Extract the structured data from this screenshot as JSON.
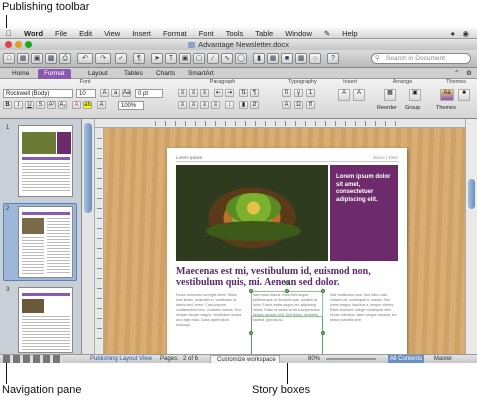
{
  "callouts": {
    "publishing_toolbar": "Publishing toolbar",
    "navigation_pane": "Navigation pane",
    "story_boxes": "Story boxes"
  },
  "menubar": {
    "items": [
      "Word",
      "File",
      "Edit",
      "View",
      "Insert",
      "Format",
      "Font",
      "Tools",
      "Table",
      "Window",
      "Help"
    ]
  },
  "window": {
    "title": "Advantage Newsletter.docx"
  },
  "toolbar": {
    "search_placeholder": "Search in Document"
  },
  "ribbon": {
    "tabs": [
      "Home",
      "Format",
      "Layout",
      "Tables",
      "Charts",
      "SmartArt"
    ],
    "active_tab": "Format",
    "groups": [
      "Font",
      "Paragraph",
      "Typography",
      "Insert",
      "Arrange",
      "Themes"
    ],
    "font_name": "Rockwell (Body)",
    "font_size": "10",
    "spacing": "0 pt",
    "zoom_field": "100%",
    "arrange_labels": [
      "Reorder",
      "Group",
      "Themes"
    ]
  },
  "thumbnails": [
    {
      "num": "1"
    },
    {
      "num": "2"
    },
    {
      "num": "3"
    }
  ],
  "page": {
    "header_left": "Lorem Ipsum",
    "header_right": "Name | Date",
    "purple_text": "Lorem ipsum dolor sit amet, consectetuer adipiscing elit.",
    "headline": "Maecenas est mi, vestibulum id, euismod non, vestibulum quis, mi. Aenean sed dolor.",
    "col1": "Fusce commodo orci eget lorem. Etiam eros lectus, venenatis in, vestibulum et, lacinia sed, lorem. Cras posuere condimentum eros. Curabitur mauris. Sed semper tempor magna. Vestibulum lacinia arcu eget nulla. Class aptent taciti sociosqu.",
    "col2": "Nam nulla mauris. Nunc felis augue, pellentesque id, tincidunt quis, sodales at, dolor. Fusce mattis augue vel, adipiscing varius. Etiam et metus at elit suscipit luctus. Nullam semper velit. Sed lectus, hendrerit facilisis, gravida ac.",
    "col3": "Sed vestibulum urna. Sed libero odio, ultricies vel, consequat id, mauris. Sed lorem magna, faucibus a, tempor ultrices. Etiam tincidunt. Integer consequat nibh. Donec interdum, diam congue volutpat, leo lectus convallis sem."
  },
  "statusbar": {
    "view": "Publishing Layout View",
    "pages_label": "Pages:",
    "pages_value": "2 of 6",
    "workspace": "Customize workspace",
    "zoom": "80%",
    "tab_all": "All Contents",
    "tab_master": "Master Pages"
  },
  "colors": {
    "accent_purple": "#6d2b6b",
    "headline_purple": "#5a2a6a",
    "canvas_wood": "#d7a86a",
    "story_box_green": "#5fa06a"
  }
}
